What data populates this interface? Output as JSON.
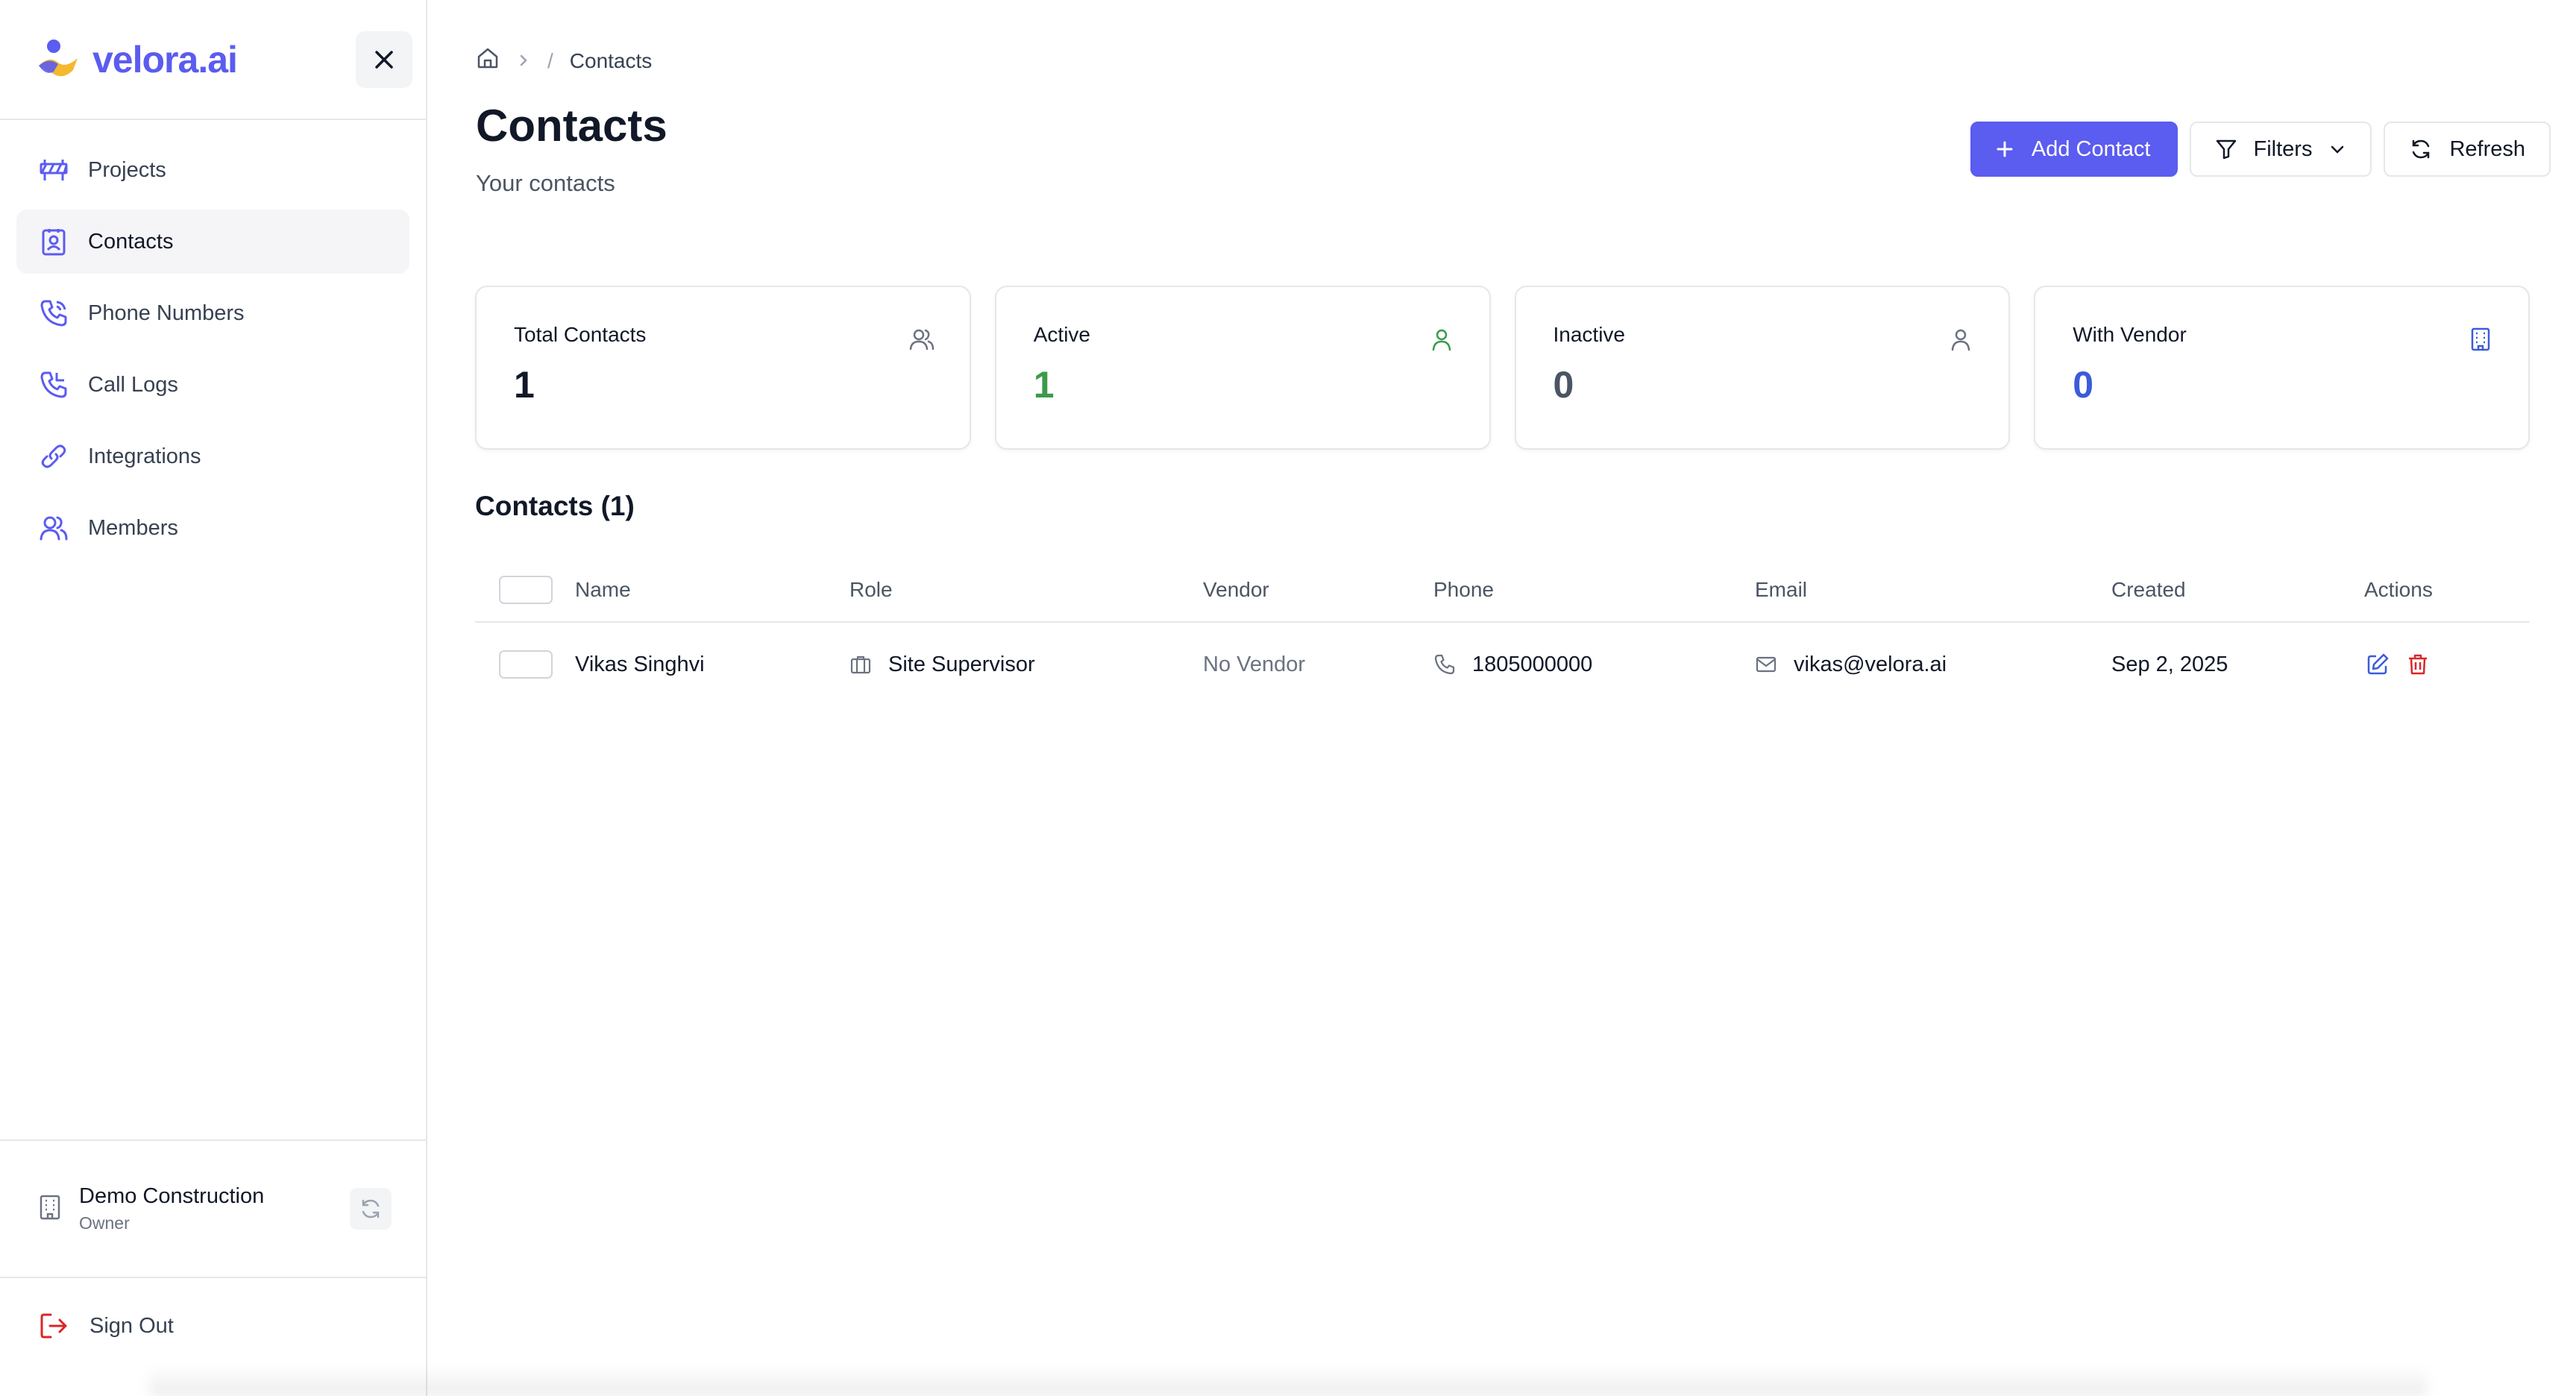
{
  "app": {
    "logo_text": "velora.ai"
  },
  "sidebar": {
    "items": [
      {
        "label": "Projects",
        "icon": "construction-barrier-icon"
      },
      {
        "label": "Contacts",
        "icon": "contact-book-icon",
        "active": true
      },
      {
        "label": "Phone Numbers",
        "icon": "phone-icon"
      },
      {
        "label": "Call Logs",
        "icon": "phone-log-icon"
      },
      {
        "label": "Integrations",
        "icon": "link-icon"
      },
      {
        "label": "Members",
        "icon": "users-icon"
      }
    ],
    "org": {
      "name": "Demo Construction",
      "role": "Owner"
    },
    "signout_label": "Sign Out"
  },
  "breadcrumb": {
    "current": "Contacts",
    "separator": "/"
  },
  "page": {
    "title": "Contacts",
    "subtitle": "Your contacts"
  },
  "toolbar": {
    "add_label": "Add Contact",
    "filters_label": "Filters",
    "refresh_label": "Refresh"
  },
  "stats": [
    {
      "label": "Total Contacts",
      "value": "1",
      "color": "#111827",
      "icon": "users-icon"
    },
    {
      "label": "Active",
      "value": "1",
      "color": "#3a9b4a",
      "icon": "user-icon"
    },
    {
      "label": "Inactive",
      "value": "0",
      "color": "#4b5563",
      "icon": "user-icon"
    },
    {
      "label": "With Vendor",
      "value": "0",
      "color": "#3b5bdb",
      "icon": "building-icon"
    }
  ],
  "contacts_section": {
    "title": "Contacts (1)"
  },
  "table": {
    "headers": {
      "name": "Name",
      "role": "Role",
      "vendor": "Vendor",
      "phone": "Phone",
      "email": "Email",
      "created": "Created",
      "actions": "Actions"
    },
    "rows": [
      {
        "name": "Vikas Singhvi",
        "role": "Site Supervisor",
        "vendor": "No Vendor",
        "phone": "1805000000",
        "email": "vikas@velora.ai",
        "created": "Sep 2, 2025"
      }
    ]
  },
  "colors": {
    "accent": "#5b5cf0",
    "edit": "#3b5bdb",
    "delete": "#dc2626",
    "signout": "#dc2626"
  }
}
